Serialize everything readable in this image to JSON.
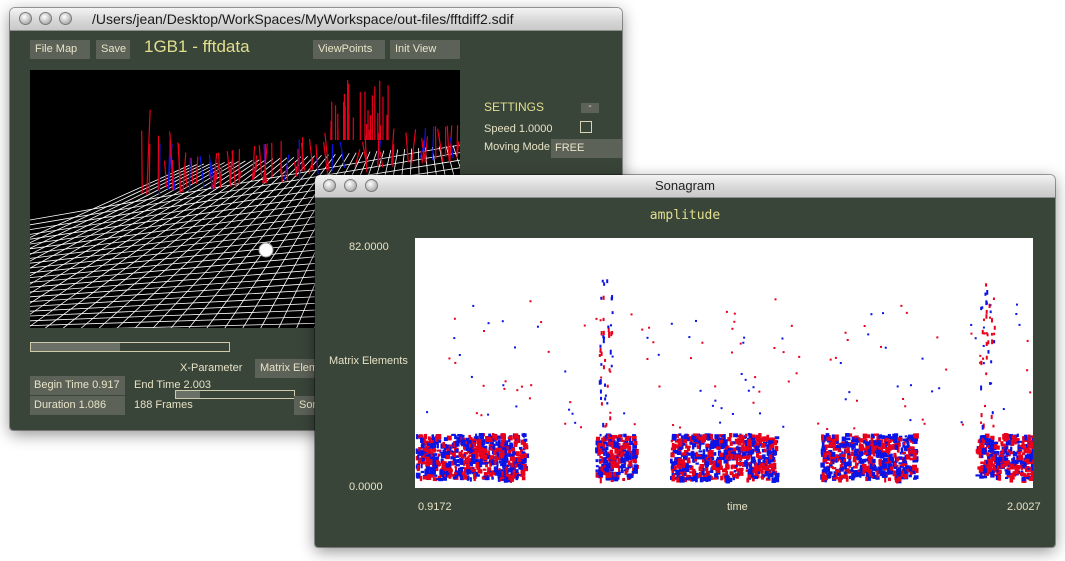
{
  "main_window": {
    "title": "/Users/jean/Desktop/WorkSpaces/MyWorkspace/out-files/fftdiff2.sdif",
    "file_map_label": "File Map",
    "save_label": "Save",
    "matrix_title": "1GB1 - fftdata",
    "viewpoints_label": "ViewPoints",
    "init_view_label": "Init View",
    "settings": {
      "heading": "SETTINGS",
      "collapse_label": "-",
      "speed_label": "Speed 1.0000",
      "moving_mode_label": "Moving Mode",
      "moving_mode_value": "FREE"
    },
    "x_parameter_label": "X-Parameter",
    "matrix_elements_button": "Matrix Eleme",
    "begin_time": "Begin Time 0.917",
    "end_time": "End Time 2.003",
    "duration": "Duration 1.086",
    "frames": "188 Frames",
    "sonagram_button": "Son",
    "progress_fraction": 0.45,
    "time_slider_fraction": 0.2
  },
  "sonagram_window": {
    "title": "Sonagram",
    "plot_title": "amplitude",
    "y_label": "Matrix Elements",
    "y_max": "82.0000",
    "y_min": "0.0000",
    "x_label": "time",
    "x_min": "0.9172",
    "x_max": "2.0027"
  },
  "colors": {
    "panel_bg": "#3a4539",
    "button_bg": "#5c6258",
    "text": "#e6e2c6",
    "red": "#e8001c",
    "blue": "#0a14e6"
  }
}
